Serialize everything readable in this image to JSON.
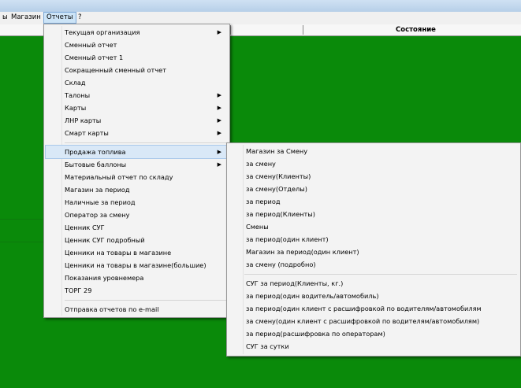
{
  "menubar": {
    "items": [
      {
        "label": "ы"
      },
      {
        "label": "Магазин"
      },
      {
        "label": "Отчеты"
      },
      {
        "label": "?"
      }
    ]
  },
  "table": {
    "header": {
      "state_label": "Состояние"
    }
  },
  "reports_menu": {
    "items": [
      {
        "label": "Текущая организация",
        "submenu": true
      },
      {
        "label": "Сменный отчет",
        "submenu": false
      },
      {
        "label": "Сменный отчет 1",
        "submenu": false
      },
      {
        "label": "Сокращенный сменный отчет",
        "submenu": false
      },
      {
        "label": "Склад",
        "submenu": false
      },
      {
        "label": "Талоны",
        "submenu": true
      },
      {
        "label": "Карты",
        "submenu": true
      },
      {
        "label": "ЛНР карты",
        "submenu": true
      },
      {
        "label": "Смарт карты",
        "submenu": true
      },
      {
        "label": "Продажа топлива",
        "submenu": true
      },
      {
        "label": "Бытовые баллоны",
        "submenu": true
      },
      {
        "label": "Материальный отчет по складу",
        "submenu": false
      },
      {
        "label": "Магазин за период",
        "submenu": false
      },
      {
        "label": "Наличные за период",
        "submenu": false
      },
      {
        "label": "Оператор за смену",
        "submenu": false
      },
      {
        "label": "Ценник СУГ",
        "submenu": false
      },
      {
        "label": "Ценник СУГ подробный",
        "submenu": false
      },
      {
        "label": "Ценники на товары в магазине",
        "submenu": false
      },
      {
        "label": "Ценники на товары в магазине(большие)",
        "submenu": false
      },
      {
        "label": "Показания уровнемера",
        "submenu": false
      },
      {
        "label": "ТОРГ 29",
        "submenu": false
      },
      {
        "label": "Отправка отчетов по e-mail",
        "submenu": false
      }
    ],
    "arrow_glyph": "▶"
  },
  "fuel_submenu": {
    "items": [
      {
        "label": "Магазин за Смену"
      },
      {
        "label": "за смену"
      },
      {
        "label": "за смену(Клиенты)"
      },
      {
        "label": "за смену(Отделы)"
      },
      {
        "label": "за период"
      },
      {
        "label": "за период(Клиенты)"
      },
      {
        "label": "Смены"
      },
      {
        "label": " за период(один клиент)"
      },
      {
        "label": "Магазин за период(один клиент)"
      },
      {
        "label": "за смену (подробно)"
      },
      {
        "label": "СУГ за период(Клиенты, кг.)"
      },
      {
        "label": "за период(один водитель/автомобиль)"
      },
      {
        "label": "за период(один клиент с расшифровкой по водителям/автомобилям"
      },
      {
        "label": "за смену(один клиент с расшифровкой по водителям/автомобилям)"
      },
      {
        "label": "за период(расшифровка по операторам)"
      },
      {
        "label": "СУГ за сутки"
      }
    ]
  },
  "colors": {
    "background": "#0a8a0a",
    "menu_bg": "#f3f3f3",
    "highlight": "#d9e8f7"
  }
}
